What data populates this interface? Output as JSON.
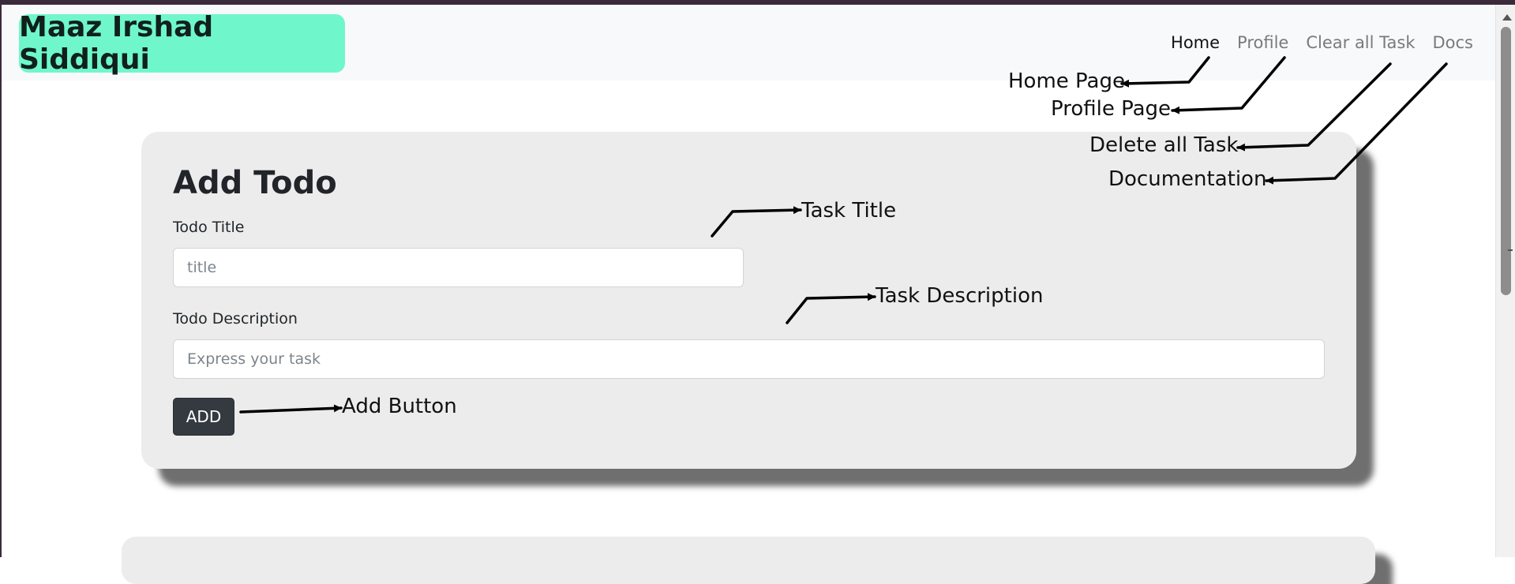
{
  "navbar": {
    "brand": "Maaz Irshad Siddiqui",
    "links": [
      "Home",
      "Profile",
      "Clear all Task",
      "Docs"
    ]
  },
  "card": {
    "title": "Add Todo",
    "title_label": "Todo Title",
    "title_placeholder": "title",
    "desc_label": "Todo Description",
    "desc_placeholder": "Express your task",
    "add_label": "ADD"
  },
  "annotations": {
    "home": "Home Page",
    "profile": "Profile Page",
    "clear": "Delete all Task",
    "docs": "Documentation",
    "task_title": "Task Title",
    "task_desc": "Task Description",
    "add_btn": "Add Button"
  },
  "colors": {
    "brand_bg": "#6ff7cb",
    "card_bg": "#ececec",
    "button_bg": "#343a40"
  }
}
